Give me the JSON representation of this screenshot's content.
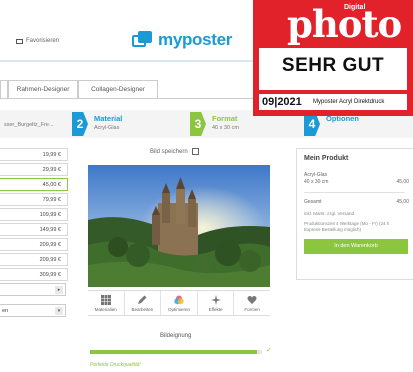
{
  "header": {
    "favorite_label": "Favorisieren",
    "brand": "myposter",
    "brand_color": "#1a9ad6",
    "accent_green": "#8cc63f"
  },
  "tabs": [
    {
      "label": ""
    },
    {
      "label": "Rahmen-Designer"
    },
    {
      "label": "Collagen-Designer"
    }
  ],
  "steps": {
    "previous_file": "sser_Burgeltz_Fre...",
    "items": [
      {
        "number": "2",
        "title": "Material",
        "subtitle": "Acryl-Glas"
      },
      {
        "number": "3",
        "title": "Format",
        "subtitle": "40 x 30 cm"
      },
      {
        "number": "4",
        "title": "Optionen",
        "subtitle": ""
      }
    ]
  },
  "sizes": {
    "prices": [
      "19,99 €",
      "29,99 €",
      "45,00 €",
      "79,99 €",
      "109,99 €",
      "149,99 €",
      "209,99 €",
      "209,99 €",
      "309,99 €"
    ],
    "selected_index": 2,
    "select_1": "",
    "select_2": "en"
  },
  "editor": {
    "save_label": "Bild speichern",
    "tools": [
      {
        "icon": "grid-icon",
        "label": "Materialien"
      },
      {
        "icon": "pencil-icon",
        "label": "Bearbeiten"
      },
      {
        "icon": "optimize-icon",
        "label": "Optimieren"
      },
      {
        "icon": "sparkle-icon",
        "label": "Effekte"
      },
      {
        "icon": "heart-icon",
        "label": "Formen"
      }
    ],
    "quality_title": "Bildeignung",
    "quality_level": 0.97,
    "quality_label": "Perfekte Druckqualität!",
    "quality_check": "✓"
  },
  "product": {
    "title": "Mein Produkt",
    "material": "Acryl-Glas",
    "format": "40 x 30 cm",
    "format_price": "45,00",
    "total_label": "Gesamt",
    "total_price": "45,00",
    "vat_note": "inkl. MwSt. zzgl. Versand",
    "delivery_note": "Produktionszeit 4 Werktage (Mo - Fr) (24 h Express-Bestellung möglich)",
    "cart_button": "In den Warenkorb"
  },
  "badge": {
    "digital": "Digital",
    "magazine": "photo",
    "verdict": "SEHR GUT",
    "issue": "09|2021",
    "product": "Myposter Acryl Direktdruck"
  }
}
